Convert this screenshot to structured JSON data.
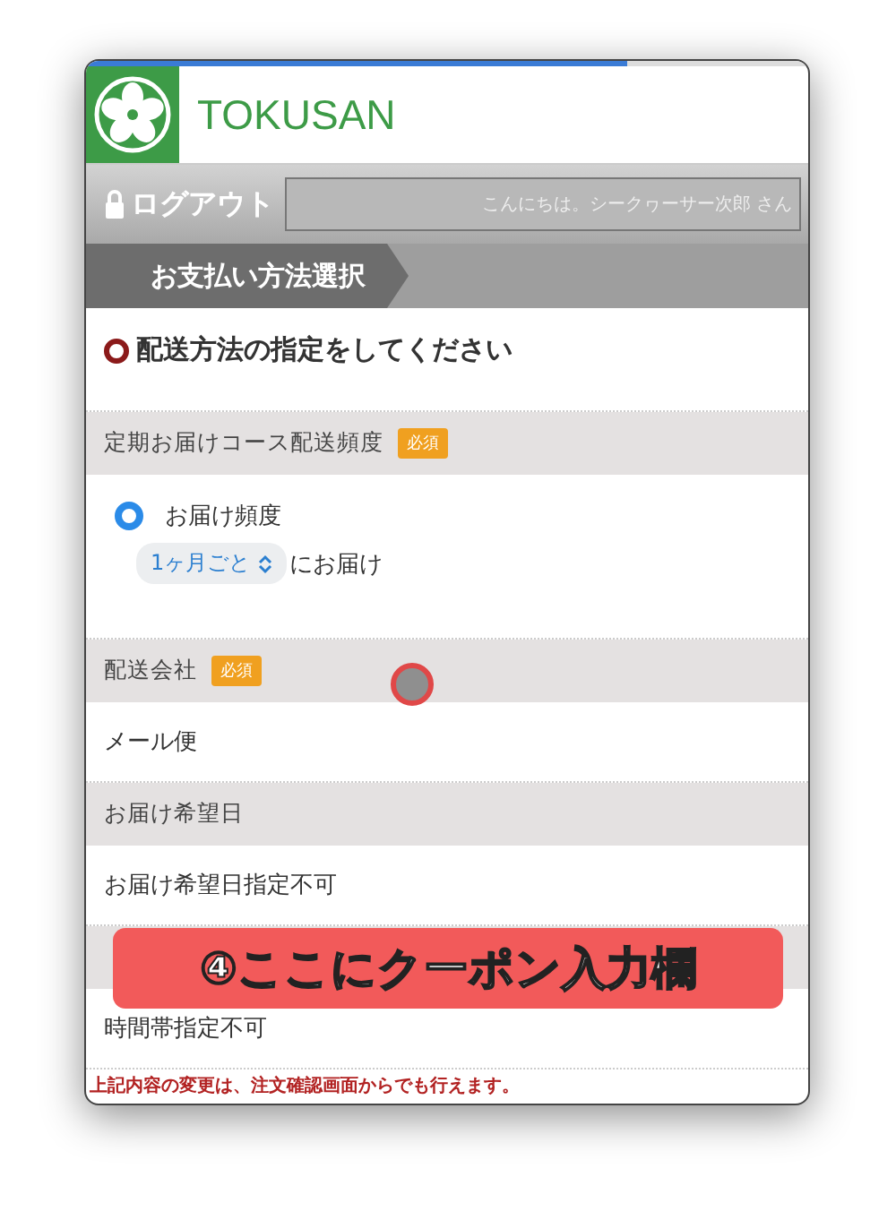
{
  "loading_bar": {
    "level": 0.75
  },
  "header": {
    "brand": "TOKUSAN"
  },
  "account_bar": {
    "logout": "ログアウト",
    "greeting": "こんにちは。シークヮーサー次郎 さん"
  },
  "breadcrumb": {
    "label": "お支払い方法選択"
  },
  "page_title": "配送方法の指定をしてください",
  "sections": [
    {
      "kind": "header",
      "label": "定期お届けコース配送頻度",
      "required_badge": "必須"
    },
    {
      "kind": "frequency",
      "option": {
        "label": "お届け頻度",
        "selected": true
      },
      "select_value": "1ヶ月ごと",
      "suffix": "にお届け"
    },
    {
      "kind": "header",
      "label": "配送会社",
      "required_badge": "必須"
    },
    {
      "kind": "row",
      "text": "メール便"
    },
    {
      "kind": "header",
      "label": "お届け希望日"
    },
    {
      "kind": "row",
      "text": "お届け希望日指定不可"
    },
    {
      "kind": "header"
    },
    {
      "kind": "row",
      "text": "時間帯指定不可"
    }
  ],
  "footer_note": "上記内容の変更は、注文確認画面からでも行えます。",
  "caption": "④ここにクーポン入力欄",
  "touch_indicator": true
}
